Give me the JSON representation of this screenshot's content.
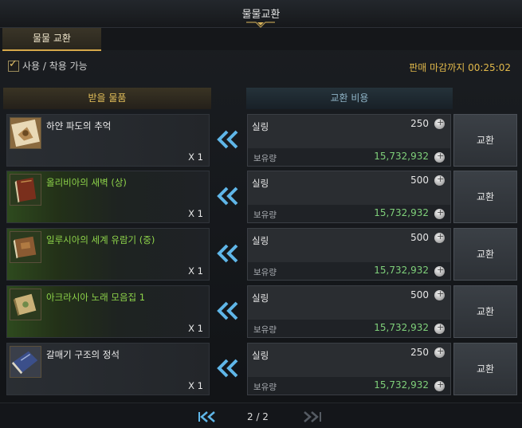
{
  "window": {
    "title": "물물교환"
  },
  "tabs": [
    {
      "label": "물물 교환"
    }
  ],
  "filter": {
    "label": "사용 / 착용 가능",
    "checked": true
  },
  "deadline": {
    "label": "판매 마감까지 00:25:02"
  },
  "headers": {
    "receive": "받을 물품",
    "cost": "교환 비용"
  },
  "rows": [
    {
      "name": "하얀 파도의 추억",
      "qty": "X 1",
      "currency": "실링",
      "price": "250",
      "owned_label": "보유량",
      "owned": "15,732,932",
      "button": "교환"
    },
    {
      "name": "올리비아의 새벽 (상)",
      "qty": "X 1",
      "currency": "실링",
      "price": "500",
      "owned_label": "보유량",
      "owned": "15,732,932",
      "button": "교환"
    },
    {
      "name": "일루시아의 세계 유람기 (중)",
      "qty": "X 1",
      "currency": "실링",
      "price": "500",
      "owned_label": "보유량",
      "owned": "15,732,932",
      "button": "교환"
    },
    {
      "name": "아크라시아 노래 모음집 1",
      "qty": "X 1",
      "currency": "실링",
      "price": "500",
      "owned_label": "보유량",
      "owned": "15,732,932",
      "button": "교환"
    },
    {
      "name": "갈매기 구조의 정석",
      "qty": "X 1",
      "currency": "실링",
      "price": "250",
      "owned_label": "보유량",
      "owned": "15,732,932",
      "button": "교환"
    }
  ],
  "pager": {
    "text": "2 / 2"
  },
  "colors": {
    "gold": "#e1b84a",
    "green_name": "#8ed44a",
    "owned_green": "#7fd07a",
    "arrow_blue": "#5fb6e8"
  },
  "icons": [
    "white-wave-book-icon",
    "red-book-icon",
    "brown-book-icon",
    "song-book-icon",
    "blue-book-icon",
    "double-left-arrow-icon",
    "silver-coin-icon",
    "first-page-icon",
    "last-page-icon"
  ]
}
